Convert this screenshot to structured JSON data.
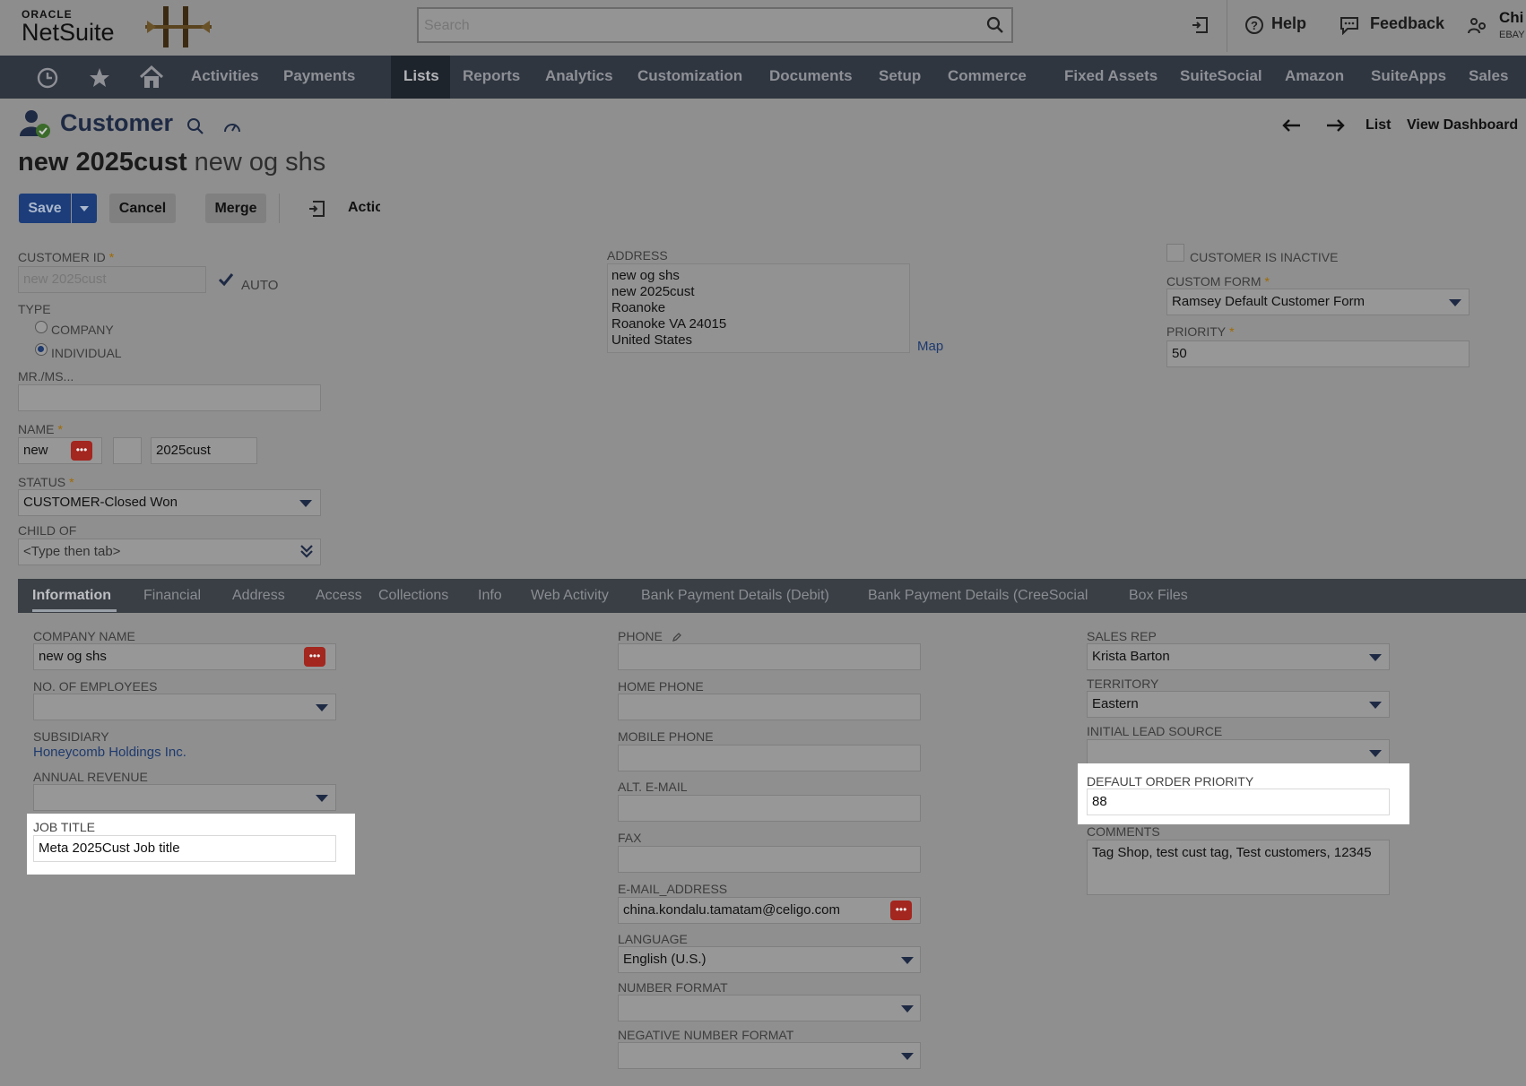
{
  "topbar": {
    "logo_oracle": "ORACLE",
    "logo_netsuite": "NetSuite",
    "search_placeholder": "Search",
    "help": "Help",
    "feedback": "Feedback",
    "user_line1": "Chi",
    "user_line2": "EBAY"
  },
  "nav": {
    "items": [
      "Activities",
      "Payments",
      "Lists",
      "Reports",
      "Analytics",
      "Customization",
      "Documents",
      "Setup",
      "Commerce",
      "Fixed Assets",
      "SuiteSocial",
      "Amazon",
      "SuiteApps",
      "Sales"
    ],
    "active": "Lists"
  },
  "header": {
    "record_type": "Customer",
    "record_id": "new 2025cust",
    "record_name": "new og shs",
    "list": "List",
    "view_dashboard": "View Dashboard"
  },
  "buttons": {
    "save": "Save",
    "cancel": "Cancel",
    "merge": "Merge",
    "actions": "Actic"
  },
  "main": {
    "customer_id_label": "CUSTOMER ID",
    "customer_id_value": "new 2025cust",
    "auto_label": "AUTO",
    "type_label": "TYPE",
    "type_company": "COMPANY",
    "type_individual": "INDIVIDUAL",
    "mr_ms_label": "MR./MS...",
    "name_label": "NAME",
    "name_first": "new",
    "name_last": "2025cust",
    "status_label": "STATUS",
    "status_value": "CUSTOMER-Closed Won",
    "child_of_label": "CHILD OF",
    "child_of_placeholder": "<Type then tab>",
    "address_label": "ADDRESS",
    "address_lines": [
      "new og shs",
      "new 2025cust",
      "Roanoke",
      "Roanoke VA 24015",
      "United States"
    ],
    "map": "Map",
    "inactive_label": "CUSTOMER IS INACTIVE",
    "custom_form_label": "CUSTOM FORM",
    "custom_form_value": "Ramsey Default Customer Form",
    "priority_label": "PRIORITY",
    "priority_value": "50"
  },
  "subtabs": [
    "Information",
    "Financial",
    "Address",
    "Access",
    "Collections",
    "Info",
    "Web Activity",
    "Bank Payment Details (Debit)",
    "Bank Payment Details (CreeSocial",
    "Box Files"
  ],
  "info": {
    "company_name_label": "COMPANY NAME",
    "company_name_value": "new og shs",
    "employees_label": "NO. OF EMPLOYEES",
    "subsidiary_label": "SUBSIDIARY",
    "subsidiary_value": "Honeycomb Holdings Inc.",
    "annual_revenue_label": "ANNUAL REVENUE",
    "job_title_label": "JOB TITLE",
    "job_title_value": "Meta 2025Cust Job title",
    "phone_label": "PHONE",
    "home_phone_label": "HOME PHONE",
    "mobile_phone_label": "MOBILE PHONE",
    "alt_email_label": "ALT. E-MAIL",
    "fax_label": "FAX",
    "email_label": "E-MAIL_ADDRESS",
    "email_value": "china.kondalu.tamatam@celigo.com",
    "language_label": "LANGUAGE",
    "language_value": "English (U.S.)",
    "number_format_label": "NUMBER FORMAT",
    "negative_number_format_label": "NEGATIVE NUMBER FORMAT",
    "sales_rep_label": "SALES REP",
    "sales_rep_value": "Krista Barton",
    "territory_label": "TERRITORY",
    "territory_value": "Eastern",
    "lead_source_label": "INITIAL LEAD SOURCE",
    "default_order_priority_label": "DEFAULT ORDER PRIORITY",
    "default_order_priority_value": "88",
    "comments_label": "COMMENTS",
    "comments_value": "Tag Shop, test cust tag, Test customers, 12345"
  },
  "colors": {
    "nav_bg": "#2f3640",
    "save_blue": "#1c3d7a",
    "dots_red": "#a3261f",
    "highlight": "#ffffff"
  }
}
